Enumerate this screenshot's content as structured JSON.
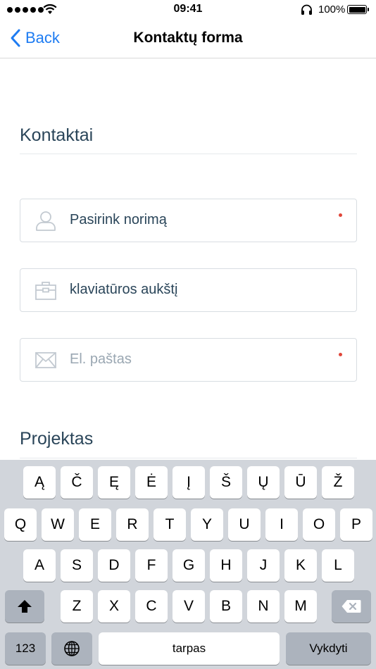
{
  "status_bar": {
    "time": "09:41",
    "battery_percent": "100%",
    "battery_level": 1.0,
    "signal_icon": "signal-dots-icon",
    "wifi_icon": "wifi-icon",
    "headphones_icon": "headphones-icon",
    "battery_icon": "battery-icon"
  },
  "nav": {
    "back_label": "Back",
    "title": "Kontaktų forma"
  },
  "form": {
    "contacts_section_title": "Kontaktai",
    "fields": [
      {
        "icon": "user-icon",
        "value": "Pasirink norimą",
        "placeholder": "",
        "required": true
      },
      {
        "icon": "briefcase-icon",
        "value": "klaviatūros aukštį",
        "placeholder": "",
        "required": false
      },
      {
        "icon": "envelope-icon",
        "value": "",
        "placeholder": "El. paštas",
        "required": true
      }
    ],
    "project_section_title": "Projektas"
  },
  "keyboard": {
    "row_special": [
      "Ą",
      "Č",
      "Ę",
      "Ė",
      "Į",
      "Š",
      "Ų",
      "Ū",
      "Ž"
    ],
    "row1": [
      "Q",
      "W",
      "E",
      "R",
      "T",
      "Y",
      "U",
      "I",
      "O",
      "P"
    ],
    "row2": [
      "A",
      "S",
      "D",
      "F",
      "G",
      "H",
      "J",
      "K",
      "L"
    ],
    "row3": [
      "Z",
      "X",
      "C",
      "V",
      "B",
      "N",
      "M"
    ],
    "shift_icon": "shift-arrow-icon",
    "delete_icon": "backspace-icon",
    "globe_icon": "globe-icon",
    "numbers_label": "123",
    "space_label": "tarpas",
    "return_label": "Vykdyti"
  },
  "colors": {
    "accent": "#1e7cf2",
    "heading": "#2a4559",
    "required_dot": "#e0463a",
    "keyboard_bg": "#d1d5db"
  }
}
